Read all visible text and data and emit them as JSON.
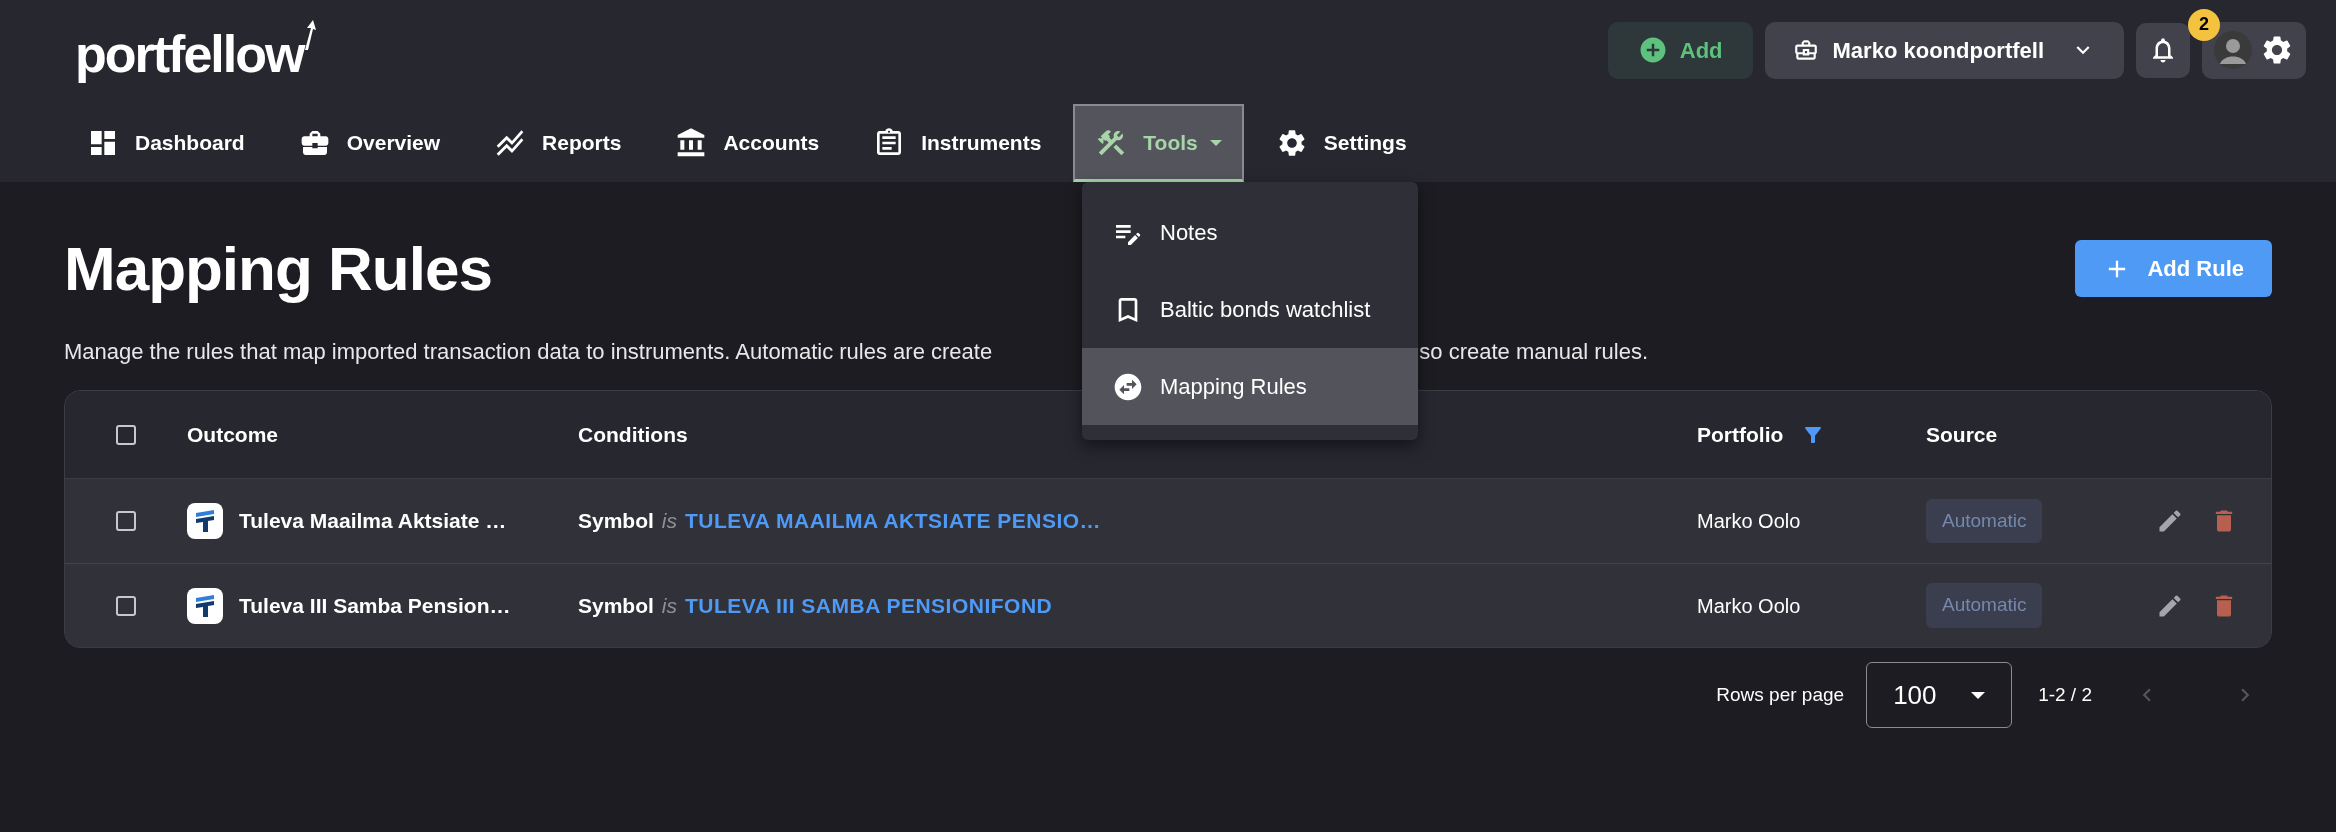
{
  "brand": {
    "logo": "portfellow"
  },
  "header": {
    "add_button": "Add",
    "portfolio_selector": "Marko koondportfell",
    "notifications": {
      "count": "2"
    }
  },
  "nav": [
    {
      "label": "Dashboard",
      "selected": false,
      "has_menu": false
    },
    {
      "label": "Overview",
      "selected": false,
      "has_menu": false
    },
    {
      "label": "Reports",
      "selected": false,
      "has_menu": false
    },
    {
      "label": "Accounts",
      "selected": false,
      "has_menu": false
    },
    {
      "label": "Instruments",
      "selected": false,
      "has_menu": false
    },
    {
      "label": "Tools",
      "selected": true,
      "has_menu": true
    },
    {
      "label": "Settings",
      "selected": false,
      "has_menu": false
    }
  ],
  "tools_menu": {
    "items": [
      {
        "label": "Notes",
        "selected": false
      },
      {
        "label": "Baltic bonds watchlist",
        "selected": false
      },
      {
        "label": "Mapping Rules",
        "selected": true
      }
    ]
  },
  "page": {
    "title": "Mapping Rules",
    "add_rule_button": "Add Rule",
    "description_parts": [
      "Manage the rules that map imported transaction data to instruments. Automatic rules are create",
      "so create manual rules."
    ]
  },
  "table": {
    "select_all_checked": false,
    "columns": [
      "Outcome",
      "Conditions",
      "Portfolio",
      "Source"
    ],
    "rows": [
      {
        "checked": false,
        "outcome": "Tuleva Maailma Aktsiate …",
        "condition_field": "Symbol",
        "operator": "is",
        "condition_value": "TULEVA MAAILMA AKTSIATE PENSIO…",
        "portfolio": "Marko Oolo",
        "source": "Automatic"
      },
      {
        "checked": false,
        "outcome": "Tuleva III Samba Pension…",
        "condition_field": "Symbol",
        "operator": "is",
        "condition_value": "TULEVA III SAMBA PENSIONIFOND",
        "portfolio": "Marko Oolo",
        "source": "Automatic"
      }
    ]
  },
  "pagination": {
    "rows_per_page_label": "Rows per page",
    "rows_per_page": "100",
    "range": "1-2 / 2"
  }
}
